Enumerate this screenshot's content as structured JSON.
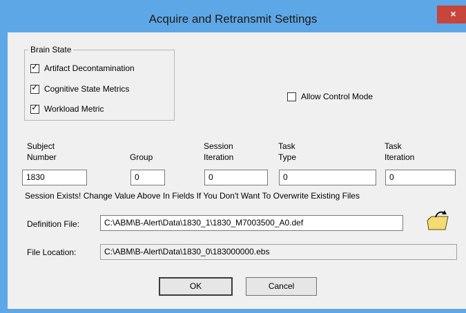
{
  "window": {
    "title": "Acquire and Retransmit Settings",
    "close_glyph": "×"
  },
  "brain_state": {
    "legend": "Brain State",
    "items": [
      {
        "label": "Artifact Decontamination",
        "checked": true
      },
      {
        "label": "Cognitive State Metrics",
        "checked": true
      },
      {
        "label": "Workload Metric",
        "checked": true
      }
    ]
  },
  "allow_control": {
    "label": "Allow Control Mode",
    "checked": false
  },
  "fields": {
    "subject": {
      "label1": "Subject",
      "label2": "Number",
      "value": "1830"
    },
    "group": {
      "label": "Group",
      "value": "0"
    },
    "session": {
      "label1": "Session",
      "label2": "Iteration",
      "value": "0"
    },
    "task_type": {
      "label1": "Task",
      "label2": "Type",
      "value": "0"
    },
    "task_iteration": {
      "label1": "Task",
      "label2": "Iteration",
      "value": "0"
    }
  },
  "warning": "Session Exists! Change Value Above In Fields If You Don't Want To Overwrite Existing Files",
  "definition_file": {
    "label": "Definition File:",
    "value": "C:\\ABM\\B-Alert\\Data\\1830_1\\1830_M7003500_A0.def",
    "icon": "folder-open-icon"
  },
  "file_location": {
    "label": "File Location:",
    "value": "C:\\ABM\\B-Alert\\Data\\1830_0\\183000000.ebs"
  },
  "buttons": {
    "ok": "OK",
    "cancel": "Cancel"
  }
}
